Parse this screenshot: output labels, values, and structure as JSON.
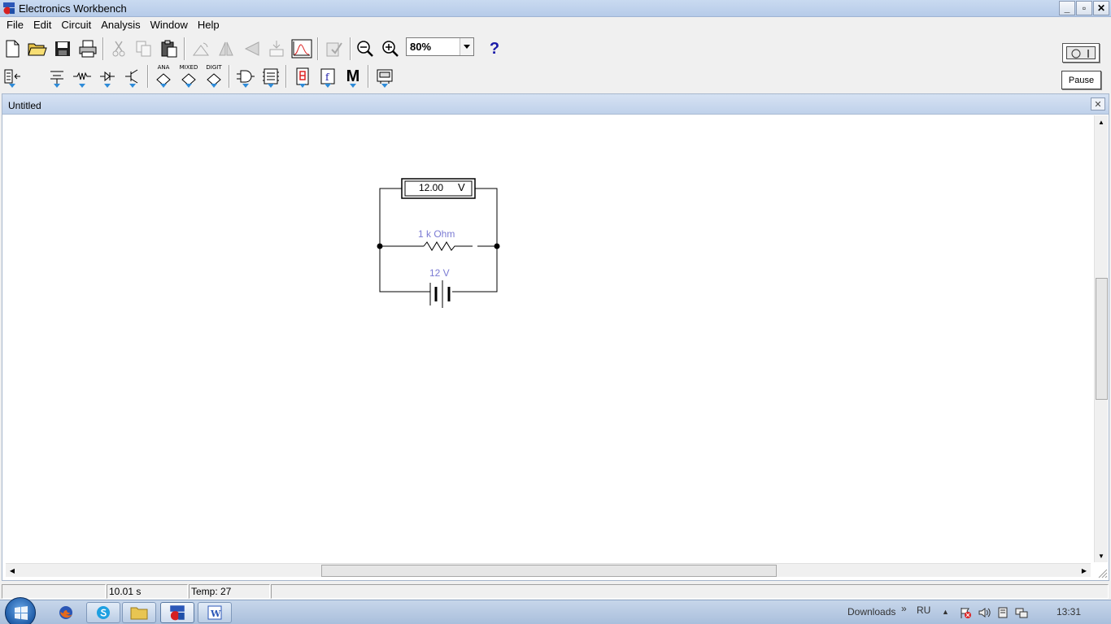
{
  "window": {
    "title": "Electronics Workbench",
    "min": "_",
    "max": "▫",
    "close": "✕"
  },
  "menu": [
    "File",
    "Edit",
    "Circuit",
    "Analysis",
    "Window",
    "Help"
  ],
  "toolbar": {
    "zoom": "80%",
    "help": "?"
  },
  "parts_bin": {
    "analog_label": "ANA",
    "mixed_label": "MIXED",
    "digital_label": "DIGIT",
    "misc_label": "M"
  },
  "controls": {
    "pause": "Pause"
  },
  "document": {
    "title": "Untitled",
    "close": "✕",
    "circuit": {
      "voltmeter_reading": "12.00",
      "voltmeter_unit": "V",
      "resistor_label": "1 k Ohm",
      "battery_label": "12 V"
    }
  },
  "status": {
    "time": "10.01 s",
    "temp": "Temp:  27"
  },
  "taskbar": {
    "downloads": "Downloads",
    "chevron": "»",
    "lang": "RU",
    "clock": "13:31"
  },
  "colors": {
    "component_label": "#7b7bd3",
    "wire": "#000000",
    "titlebar": "#c9daf0"
  }
}
